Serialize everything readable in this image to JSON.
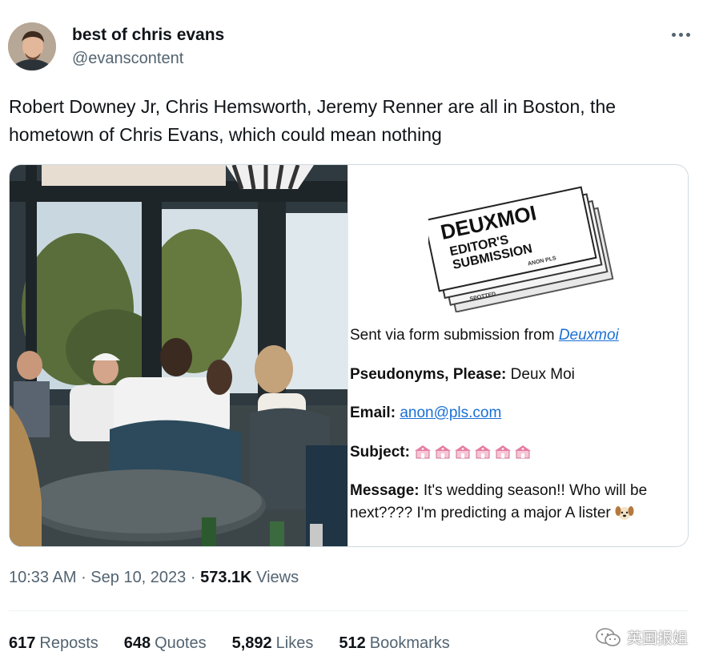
{
  "user": {
    "display_name": "best of chris evans",
    "handle": "@evanscontent"
  },
  "tweet": {
    "text": "Robert Downey Jr, Chris Hemsworth, Jeremy Renner are all in Boston, the hometown of Chris Evans, which could mean nothing"
  },
  "screenshot_card": {
    "paper_title": "DEUXMOI",
    "paper_line1": "EDITOR'S",
    "paper_line2": "SUBMISSION",
    "paper_small1": "ANON PLS",
    "paper_small2": "SPOTTED",
    "sent_via_prefix": "Sent via form submission from ",
    "sent_via_link": "Deuxmoi",
    "pseudonyms_label": "Pseudonyms, Please:",
    "pseudonyms_value": " Deux Moi",
    "email_label": "Email:",
    "email_value": "anon@pls.com",
    "subject_label": "Subject:",
    "message_label": "Message:",
    "message_line1": " It's wedding season!! Who will be",
    "message_line2": "next???? I'm predicting a major A lister"
  },
  "meta": {
    "time": "10:33 AM",
    "sep1": " · ",
    "date": "Sep 10, 2023",
    "sep2": " · ",
    "views_count": "573.1K",
    "views_label": " Views"
  },
  "stats": {
    "reposts_count": "617",
    "reposts_label": "Reposts",
    "quotes_count": "648",
    "quotes_label": "Quotes",
    "likes_count": "5,892",
    "likes_label": "Likes",
    "bookmarks_count": "512",
    "bookmarks_label": "Bookmarks"
  },
  "watermark": {
    "text": "英国报姐"
  },
  "colors": {
    "text_primary": "#0f1419",
    "text_secondary": "#536471",
    "link": "#1a6fd6",
    "border": "#cfd9de"
  },
  "icons": {
    "more": "more-dots-icon",
    "house_emoji": "wedding-chapel-emoji",
    "dog_emoji": "dog-face-emoji",
    "watermark": "wechat-icon"
  }
}
